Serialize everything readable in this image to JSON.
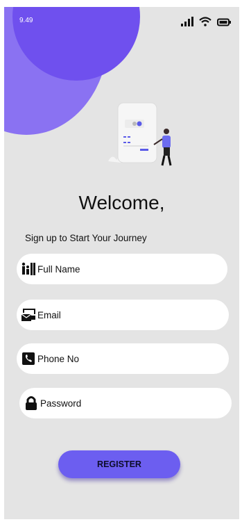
{
  "status_bar": {
    "time": "9.49",
    "signal_icon": "signal-bars-icon",
    "wifi_icon": "wifi-icon",
    "battery_icon": "battery-icon"
  },
  "header": {
    "title": "Welcome,",
    "subtitle": "Sign up to Start Your Journey"
  },
  "form": {
    "full_name": {
      "label": "Full Name",
      "icon": "family-icon"
    },
    "email": {
      "label": "Email",
      "icon": "mail-icon"
    },
    "phone": {
      "label": "Phone No",
      "icon": "phone-icon"
    },
    "password": {
      "label": "Password",
      "icon": "lock-icon"
    }
  },
  "register_button": {
    "label": "REGISTER"
  },
  "colors": {
    "accent": "#6c5ef0",
    "blob_light": "#8a72f2",
    "blob_dark": "#6f50ee",
    "background": "#e4e4e4"
  }
}
